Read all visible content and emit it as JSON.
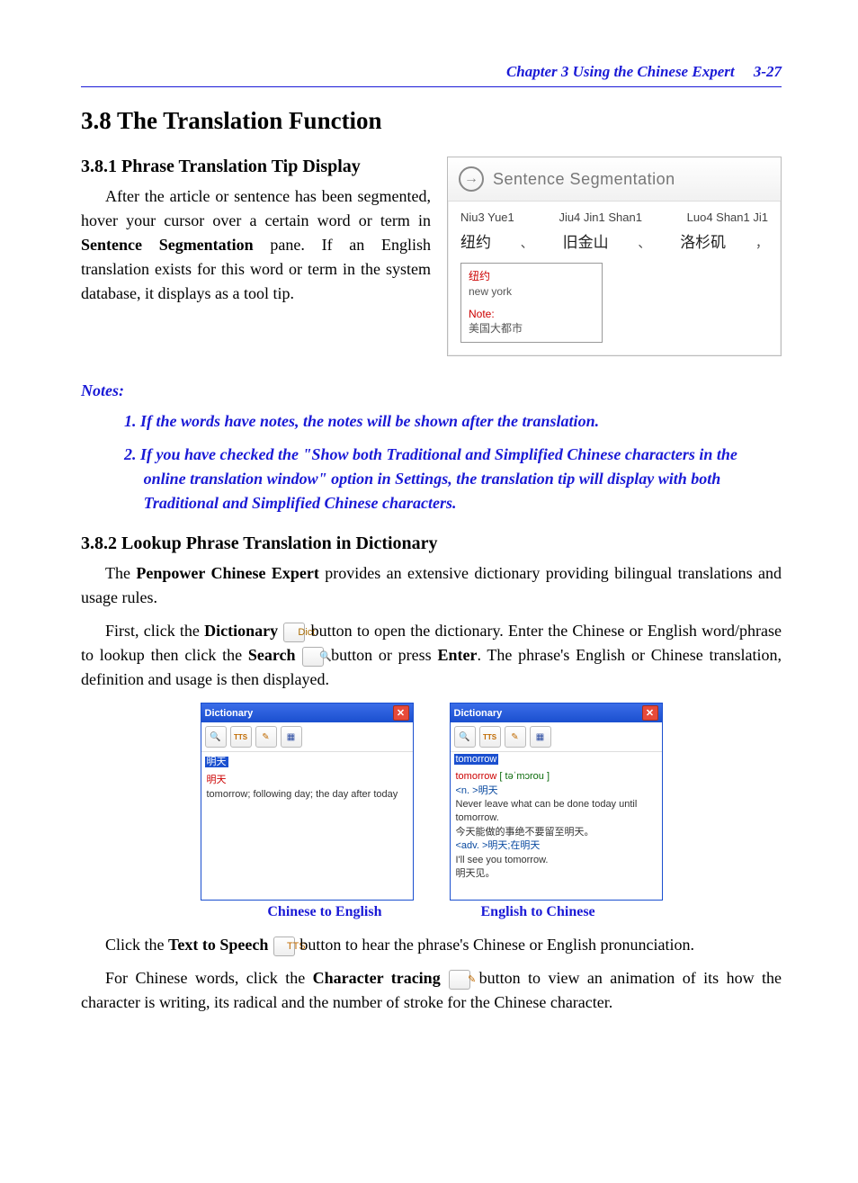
{
  "header": {
    "chapter": "Chapter 3  Using the Chinese Expert",
    "pagenum": "3-27"
  },
  "section": {
    "title": "3.8  The Translation Function"
  },
  "sub1": {
    "title": "3.8.1  Phrase Translation Tip Display",
    "para_pre": "After the article or sentence has been segmented, hover your cursor over a certain word or term in ",
    "para_boldinline": "Sentence Segmentation",
    "para_post": " pane. If an English translation exists for this word or term in the system database, it displays as a tool tip."
  },
  "segfig": {
    "title": "Sentence Segmentation",
    "pinyin": [
      "Niu3 Yue1",
      "Jiu4 Jin1 Shan1",
      "Luo4 Shan1 Ji1"
    ],
    "cjk": [
      "纽约",
      "旧金山",
      "洛杉矶"
    ],
    "tooltip": {
      "word": "纽约",
      "trans": "new york",
      "note_label": "Note:",
      "note_body": "美国大都市"
    }
  },
  "notes": {
    "heading": "Notes:",
    "items": [
      "If the words have notes, the notes will be shown after the translation.",
      "If you have checked the \"Show both Traditional and Simplified Chinese characters in the online translation window\" option in Settings, the translation tip will display with both Traditional and Simplified Chinese characters."
    ]
  },
  "sub2": {
    "title": "3.8.2  Lookup Phrase Translation in Dictionary",
    "p1_pre": "The ",
    "p1_bold": "Penpower Chinese Expert",
    "p1_post": " provides an extensive dictionary providing bilingual translations and usage rules.",
    "p2_a": "First, click the ",
    "p2_bold1": "Dictionary",
    "p2_b": " button to open the dictionary. Enter the Chinese or English word/phrase to lookup then click the ",
    "p2_bold2": "Search",
    "p2_c": " button or press ",
    "p2_bold3": "Enter",
    "p2_d": ". The phrase's English or Chinese translation, definition and usage is then displayed.",
    "p3_a": "Click the ",
    "p3_bold": "Text to Speech",
    "p3_b": " button to hear the phrase's Chinese or English pronunciation.",
    "p4_a": "For Chinese words, click the ",
    "p4_bold": "Character tracing",
    "p4_b": " button to view an animation of its how the character is writing, its radical and the number of stroke for the Chinese character."
  },
  "dict": {
    "title": "Dictionary",
    "left": {
      "input": "明天",
      "headword": "明天",
      "def": "tomorrow; following day; the day after today"
    },
    "right": {
      "input": "tomorrow",
      "headword": "tomorrow",
      "phon": " [ təˈmɔrou ]",
      "lines": [
        "<n. >明天",
        "Never leave what can be done today until tomorrow.",
        "今天能做的事绝不要留至明天。",
        "<adv. >明天;在明天",
        "I'll see you tomorrow.",
        "明天见。"
      ]
    },
    "captions": [
      "Chinese to English",
      "English to Chinese"
    ]
  }
}
